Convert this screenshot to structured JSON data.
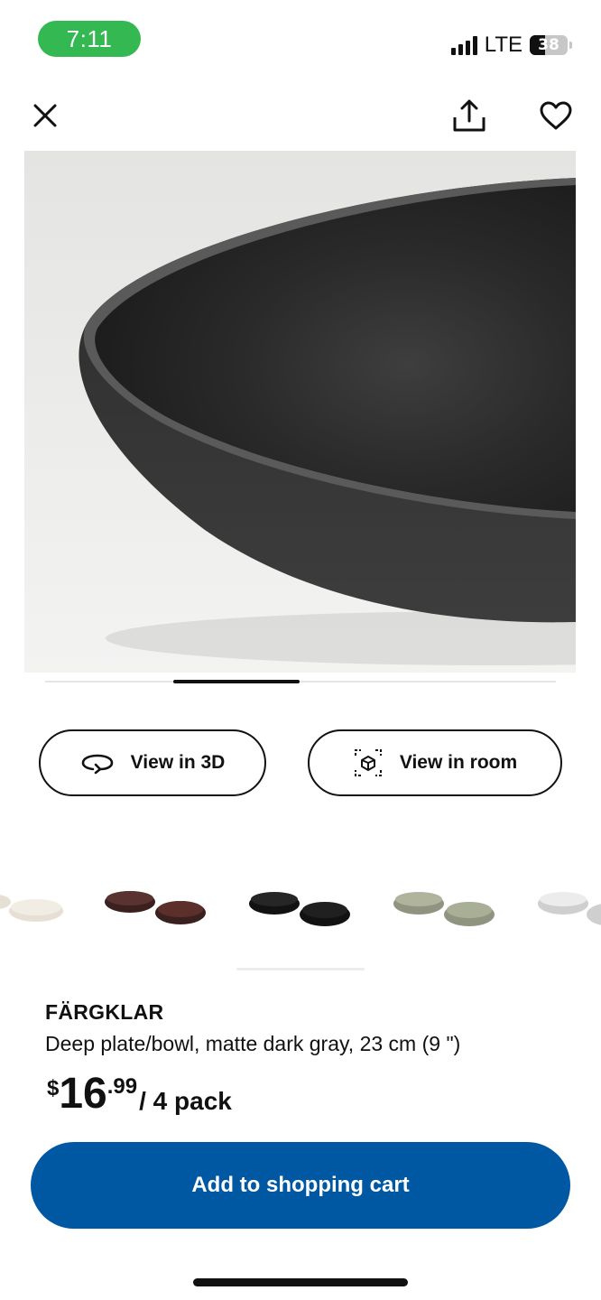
{
  "status_bar": {
    "time": "7:11",
    "network": "LTE",
    "battery": "38",
    "battery_level_percent": 38
  },
  "toolbar": {
    "close_icon": "close-icon",
    "share_icon": "share-icon",
    "favorite_icon": "heart-icon"
  },
  "gallery": {
    "image_alt_icon": "product-photo",
    "slide_progress_fraction": 0.25
  },
  "view_buttons": {
    "view_3d_label": "View in 3D",
    "view_3d_icon": "rotate-3d-icon",
    "view_room_label": "View in room",
    "view_room_icon": "ar-cube-icon"
  },
  "variants": [
    {
      "color": "#e8e2d6",
      "name_icon": "beige-bowl-variant"
    },
    {
      "color": "#4a2a26",
      "name_icon": "brown-bowl-variant"
    },
    {
      "color": "#1c1c1c",
      "name_icon": "black-bowl-variant"
    },
    {
      "color": "#a9ae96",
      "name_icon": "green-bowl-variant"
    },
    {
      "color": "#dedede",
      "name_icon": "white-bowl-variant"
    }
  ],
  "product": {
    "brand": "FÄRGKLAR",
    "description": "Deep plate/bowl, matte dark gray, 23 cm (9 \")",
    "price_currency": "$",
    "price_integer": "16",
    "price_decimal": ".99",
    "price_unit": "/ 4 pack"
  },
  "cart": {
    "add_label": "Add to shopping cart"
  },
  "colors": {
    "accent": "#0058a3",
    "time_pill": "#34b852"
  }
}
